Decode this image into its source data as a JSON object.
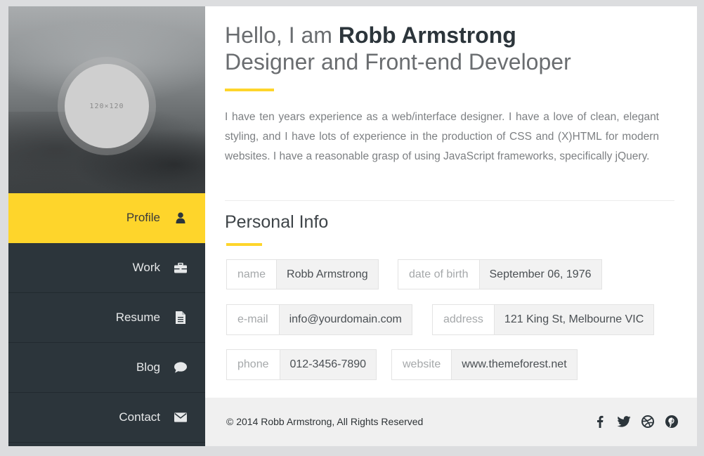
{
  "avatar_placeholder": "120×120",
  "nav": [
    {
      "label": "Profile",
      "icon": "user-icon"
    },
    {
      "label": "Work",
      "icon": "briefcase-icon"
    },
    {
      "label": "Resume",
      "icon": "document-icon"
    },
    {
      "label": "Blog",
      "icon": "comment-icon"
    },
    {
      "label": "Contact",
      "icon": "envelope-icon"
    }
  ],
  "header": {
    "greeting_prefix": "Hello, I am ",
    "name": "Robb Armstrong",
    "role": "Designer and Front-end Developer"
  },
  "bio": "I have ten years experience as a web/interface designer. I have a love of clean, elegant styling, and I have lots of experience in the production of CSS and (X)HTML for modern websites. I have a reasonable grasp of using JavaScript frameworks, specifically jQuery.",
  "personal_info": {
    "title": "Personal Info",
    "name_label": "name",
    "name_value": "Robb Armstrong",
    "dob_label": "date of birth",
    "dob_value": "September 06, 1976",
    "email_label": "e-mail",
    "email_value": "info@yourdomain.com",
    "address_label": "address",
    "address_value": "121 King St, Melbourne VIC",
    "phone_label": "phone",
    "phone_value": "012-3456-7890",
    "website_label": "website",
    "website_value": "www.themeforest.net"
  },
  "footer": {
    "copyright": "© 2014 Robb Armstrong, All Rights Reserved",
    "social": [
      "facebook-icon",
      "twitter-icon",
      "dribbble-icon",
      "pinterest-icon"
    ]
  },
  "colors": {
    "accent": "#fed52b",
    "sidebar": "#2c353b",
    "footer": "#f0f0f0"
  }
}
